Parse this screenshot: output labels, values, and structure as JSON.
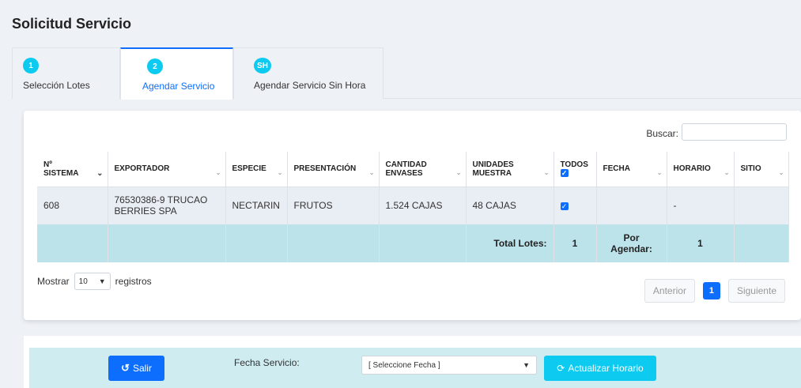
{
  "page": {
    "title": "Solicitud Servicio"
  },
  "steps": [
    {
      "badge": "1",
      "label": "Selección Lotes"
    },
    {
      "badge": "2",
      "label": "Agendar Servicio"
    },
    {
      "badge": "SH",
      "label": "Agendar Servicio Sin Hora"
    }
  ],
  "search": {
    "label": "Buscar:",
    "value": ""
  },
  "table": {
    "headers": {
      "sistema_line1": "Nº",
      "sistema_line2": "SISTEMA",
      "exportador": "EXPORTADOR",
      "especie": "ESPECIE",
      "presentacion": "PRESENTACIÓN",
      "cantidad_line1": "CANTIDAD",
      "cantidad_line2": "ENVASES",
      "unidades_line1": "UNIDADES",
      "unidades_line2": "MUESTRA",
      "todos": "TODOS",
      "fecha": "FECHA",
      "horario": "HORARIO",
      "sitio": "SITIO"
    },
    "rows": [
      {
        "sistema": "608",
        "exportador": "76530386-9 TRUCAO BERRIES SPA",
        "especie": "NECTARIN",
        "presentacion": "FRUTOS",
        "cantidad": "1.524 CAJAS",
        "unidades": "48 CAJAS",
        "fecha": "",
        "horario": "-",
        "sitio": ""
      }
    ],
    "totals": {
      "lotes_label": "Total Lotes:",
      "lotes_value": "1",
      "agendar_line1": "Por",
      "agendar_line2": "Agendar:",
      "agendar_value": "1"
    }
  },
  "length": {
    "label_before": "Mostrar",
    "value": "10",
    "label_after": "registros"
  },
  "pager": {
    "prev": "Anterior",
    "current": "1",
    "next": "Siguiente"
  },
  "actions": {
    "salir": "Salir",
    "fecha_label": "Fecha Servicio:",
    "fecha_placeholder": "[ Seleccione Fecha ]",
    "actualizar": "Actualizar Horario"
  },
  "colors": {
    "primary": "#0d6efd",
    "info": "#0dcaf0",
    "totals_row": "#bde3ea",
    "action_bar": "#cfecf1"
  }
}
